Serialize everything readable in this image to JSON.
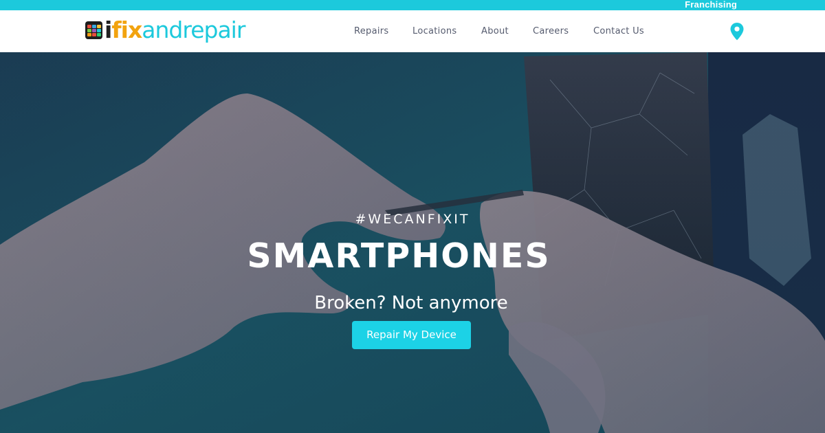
{
  "topbar": {
    "franchising_label": "Franchising"
  },
  "brand": {
    "name_i": "i",
    "name_fix": "fix",
    "name_rest": "andrepair",
    "colors": {
      "accent": "#1cc9dc",
      "fix_orange": "#f2a30f",
      "dark": "#222222"
    }
  },
  "nav": {
    "items": [
      {
        "label": "Repairs"
      },
      {
        "label": "Locations"
      },
      {
        "label": "About"
      },
      {
        "label": "Careers"
      },
      {
        "label": "Contact Us"
      }
    ],
    "location_icon": "map-pin-icon"
  },
  "hero": {
    "tagline": "#WECANFIXIT",
    "headline": "SMARTPHONES",
    "subline": "Broken? Not anymore",
    "cta_label": "Repair My Device",
    "background_image": "hands repairing a phone with cracked screen"
  }
}
